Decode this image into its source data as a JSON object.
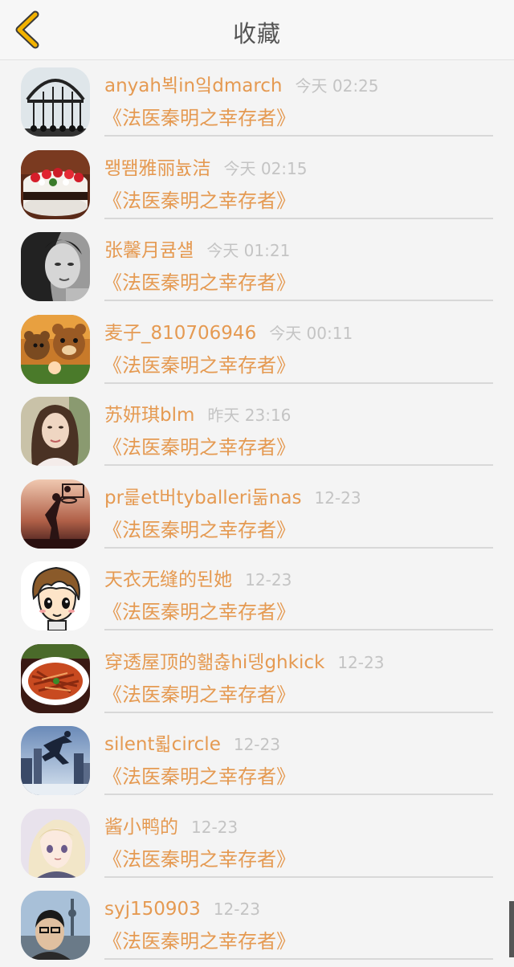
{
  "header": {
    "title": "收藏",
    "back_icon": "chevron-left-icon",
    "accent_color": "#f2b200"
  },
  "colors": {
    "name": "#e59a52",
    "time": "#c4c4c4",
    "book": "#e59a52"
  },
  "items": [
    {
      "name": "anyah뵉in잌dmarch",
      "time": "今天 02:25",
      "book": "《法医秦明之幸存者》",
      "avatar": "gate-avatar"
    },
    {
      "name": "뫵뙘雅丽늀洁",
      "time": "今天 02:15",
      "book": "《法医秦明之幸存者》",
      "avatar": "cake-avatar"
    },
    {
      "name": "张馨月큠섈",
      "time": "今天 01:21",
      "book": "《法医秦明之幸存者》",
      "avatar": "bw-portrait-avatar"
    },
    {
      "name": "麦子_810706946",
      "time": "今天 00:11",
      "book": "《法医秦明之幸存者》",
      "avatar": "cartoon-bears-avatar"
    },
    {
      "name": "苏妍琪blm",
      "time": "昨天 23:16",
      "book": "《法医秦明之幸存者》",
      "avatar": "woman-portrait-avatar"
    },
    {
      "name": "pr릁et버tyballeri둚nas",
      "time": "12-23",
      "book": "《法医秦明之幸存者》",
      "avatar": "basketball-avatar"
    },
    {
      "name": "天衣无缝的된她",
      "time": "12-23",
      "book": "《法医秦明之幸存者》",
      "avatar": "cartoon-boy-avatar"
    },
    {
      "name": "穿透屋顶的홺츊hi뎅ghkick",
      "time": "12-23",
      "book": "《法医秦明之幸存者》",
      "avatar": "food-dish-avatar"
    },
    {
      "name": "silent뢻circle",
      "time": "12-23",
      "book": "《法医秦明之幸存者》",
      "avatar": "city-jump-avatar"
    },
    {
      "name": "酱小鸭的",
      "time": "12-23",
      "book": "《法医秦明之幸存者》",
      "avatar": "anime-girl-avatar"
    },
    {
      "name": "syj150903",
      "time": "12-23",
      "book": "《法医秦明之幸存者》",
      "avatar": "selfie-avatar"
    }
  ]
}
